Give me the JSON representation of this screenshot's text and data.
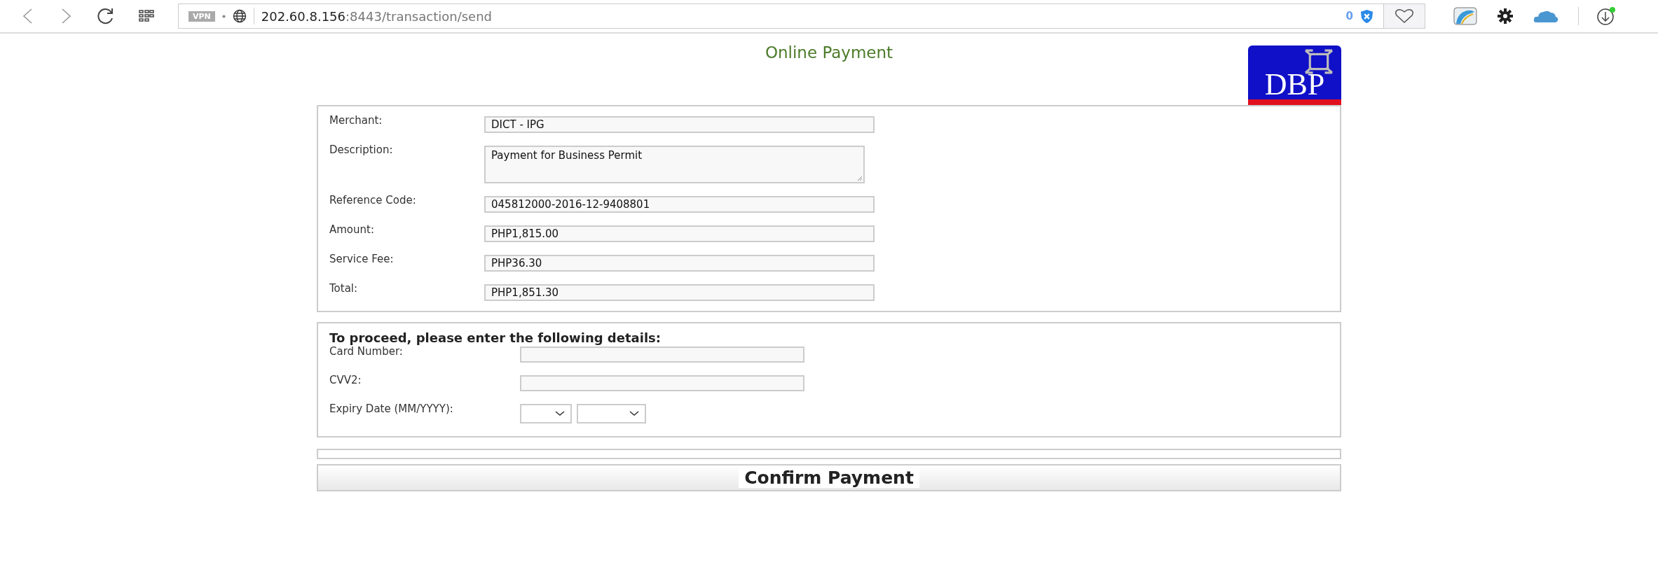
{
  "browser": {
    "vpn_label": "VPN",
    "url_host": "202.60.8.156",
    "url_path": ":8443/transaction/send",
    "tracker_count": "0"
  },
  "title": "Online Payment",
  "logo_text": "DBP",
  "details": [
    {
      "label": "Merchant:",
      "value": "DICT - IPG",
      "kind": "input"
    },
    {
      "label": "Description:",
      "value": "Payment for Business Permit",
      "kind": "textarea"
    },
    {
      "label": "Reference Code:",
      "value": "045812000-2016-12-9408801",
      "kind": "input"
    },
    {
      "label": "Amount:",
      "value": "PHP1,815.00",
      "kind": "input"
    },
    {
      "label": "Service Fee:",
      "value": "PHP36.30",
      "kind": "input"
    },
    {
      "label": "Total:",
      "value": "PHP1,851.30",
      "kind": "input"
    }
  ],
  "proceed": {
    "heading": "To proceed, please enter the following details:",
    "fields": [
      {
        "label": "Card Number:",
        "kind": "text"
      },
      {
        "label": "CVV2:",
        "kind": "text"
      },
      {
        "label": "Expiry Date (MM/YYYY):",
        "kind": "date-selects"
      }
    ]
  },
  "confirm_button": "Confirm Payment"
}
